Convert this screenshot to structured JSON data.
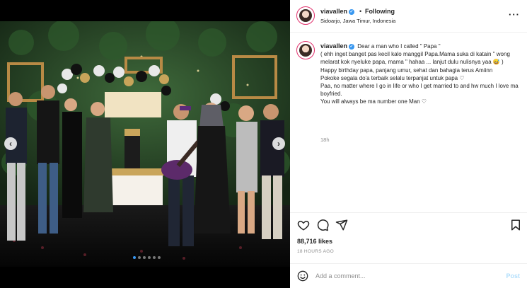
{
  "post": {
    "username": "viavallen",
    "following_label": "Following",
    "separator": "•",
    "location": "Sidoarjo, Jawa Timur, Indonesia",
    "more_icon": "more-horizontal-icon",
    "verified_icon": "verified-badge-icon"
  },
  "caption": {
    "username": "viavallen",
    "lines": [
      "Dear a man who I called \" Papa \"",
      "( ehh inget banget pas kecil kalo manggil Papa.Mama suka di katain \" wong melarat kok nyeluke papa, mama \" hahaa ... lanjut dulu nulisnya yaa 😅 )",
      "Happy birthday papa, panjang umur, sehat dan bahagia terus Amiinn",
      "Pokoke segala do'a terbaik selalu terpanjat untuk papa ♡",
      "Paa, no matter where I go in life or who I get married to and hw much I love ma boyfried.",
      "You will always be ma number one Man ♡"
    ],
    "relative_time": "18h"
  },
  "media": {
    "carousel_total": 6,
    "carousel_active_index": 0,
    "prev_icon": "chevron-left-icon",
    "next_icon": "chevron-right-icon"
  },
  "actions": {
    "like_icon": "heart-icon",
    "comment_icon": "comment-icon",
    "share_icon": "send-icon",
    "save_icon": "bookmark-icon"
  },
  "stats": {
    "likes": "88,716 likes",
    "time_ago": "18 HOURS AGO"
  },
  "comment": {
    "emoji_icon": "emoji-icon",
    "placeholder": "Add a comment...",
    "post_label": "Post"
  },
  "colors": {
    "accent": "#3897f0",
    "post_disabled": "#b2dffc",
    "text": "#262626",
    "muted": "#8e8e8e"
  }
}
